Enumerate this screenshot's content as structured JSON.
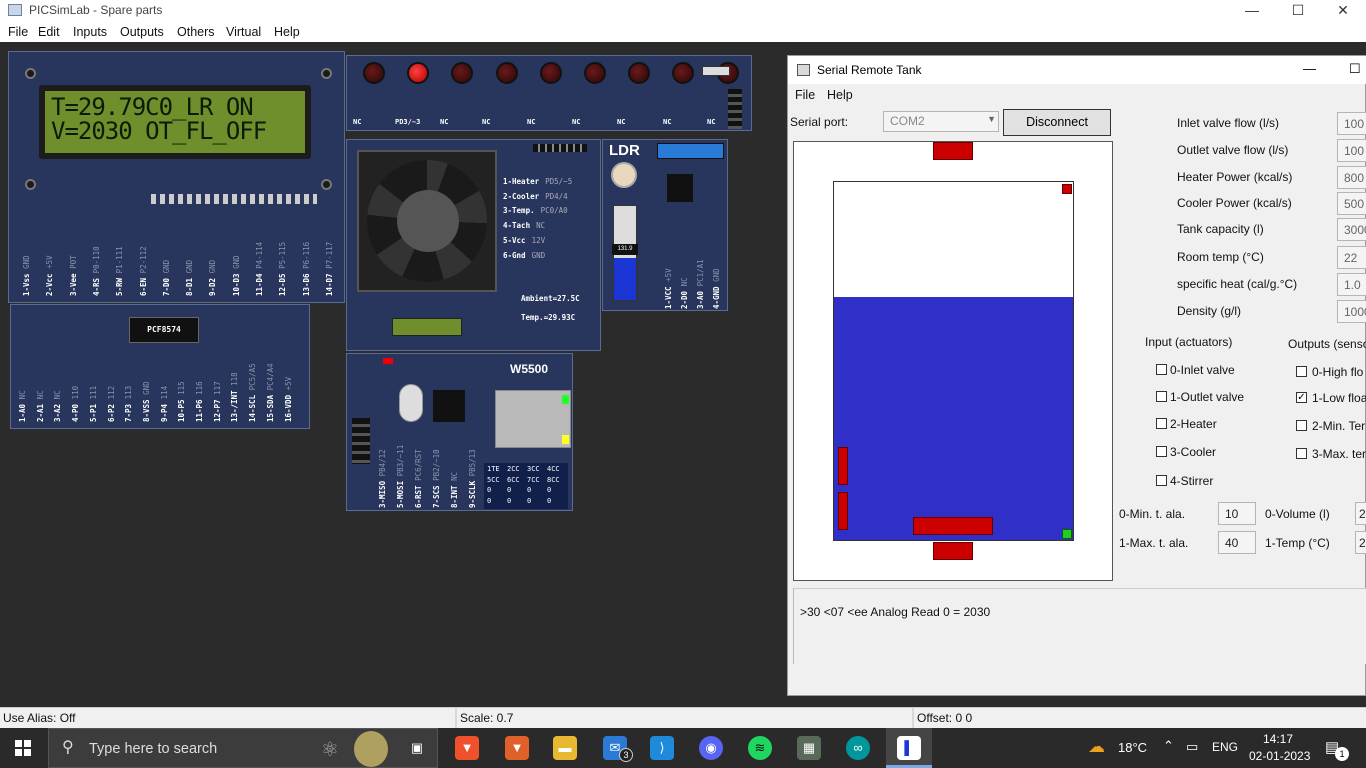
{
  "window": {
    "title": "PICSimLab - Spare parts",
    "minimize": "—",
    "maximize": "☐",
    "close": "✕"
  },
  "menu": [
    "File",
    "Edit",
    "Inputs",
    "Outputs",
    "Others",
    "Virtual",
    "Help"
  ],
  "lcd": {
    "line1": "T=29.79C0_LR ON",
    "line2": "V=2030 OT_FL_OFF",
    "pins": [
      {
        "n": "1-Vss",
        "s": "GND"
      },
      {
        "n": "2-Vcc",
        "s": "+5V"
      },
      {
        "n": "3-Vee",
        "s": "POT"
      },
      {
        "n": "4-RS",
        "s": "P0-110"
      },
      {
        "n": "5-RW",
        "s": "P1-111"
      },
      {
        "n": "6-EN",
        "s": "P2-112"
      },
      {
        "n": "7-D0",
        "s": "GND"
      },
      {
        "n": "8-D1",
        "s": "GND"
      },
      {
        "n": "9-D2",
        "s": "GND"
      },
      {
        "n": "10-D3",
        "s": "GND"
      },
      {
        "n": "11-D4",
        "s": "P4-114"
      },
      {
        "n": "12-D5",
        "s": "P5-115"
      },
      {
        "n": "13-D6",
        "s": "P6-116"
      },
      {
        "n": "14-D7",
        "s": "P7-117"
      }
    ]
  },
  "pcf": {
    "chip": "PCF8574",
    "pins": [
      {
        "n": "1-A0",
        "s": "NC"
      },
      {
        "n": "2-A1",
        "s": "NC"
      },
      {
        "n": "3-A2",
        "s": "NC"
      },
      {
        "n": "4-P0",
        "s": "110"
      },
      {
        "n": "5-P1",
        "s": "111"
      },
      {
        "n": "6-P2",
        "s": "112"
      },
      {
        "n": "7-P3",
        "s": "113"
      },
      {
        "n": "8-VSS",
        "s": "GND"
      },
      {
        "n": "9-P4",
        "s": "114"
      },
      {
        "n": "10-P5",
        "s": "115"
      },
      {
        "n": "11-P6",
        "s": "116"
      },
      {
        "n": "12-P7",
        "s": "117"
      },
      {
        "n": "13-/INT",
        "s": "118"
      },
      {
        "n": "14-SCL",
        "s": "PC5/A5"
      },
      {
        "n": "15-SDA",
        "s": "PC4/A4"
      },
      {
        "n": "16-VDD",
        "s": "+5V"
      }
    ]
  },
  "leds": {
    "labels": [
      "NC",
      "PD3/~3",
      "NC",
      "NC",
      "NC",
      "NC",
      "NC",
      "NC",
      "NC"
    ],
    "states": [
      false,
      true,
      false,
      false,
      false,
      false,
      false,
      false,
      false
    ]
  },
  "fan": {
    "pins": [
      {
        "n": "1-Heater",
        "s": "PD5/~5"
      },
      {
        "n": "2-Cooler",
        "s": "PD4/4"
      },
      {
        "n": "3-Temp.",
        "s": "PC0/A0"
      },
      {
        "n": "4-Tach",
        "s": "NC"
      },
      {
        "n": "5-Vcc",
        "s": "12V"
      },
      {
        "n": "6-Gnd",
        "s": "GND"
      }
    ],
    "ambient": "Ambient=27.5C",
    "temp": "Temp.=29.93C"
  },
  "ldr": {
    "title": "LDR",
    "value": "131.9",
    "pins": [
      {
        "n": "1-VCC",
        "s": "+5V"
      },
      {
        "n": "2-D0",
        "s": "NC"
      },
      {
        "n": "3-A0",
        "s": "PC1/A1"
      },
      {
        "n": "4-GND",
        "s": "GND"
      }
    ]
  },
  "w5500": {
    "title": "W5500",
    "pins": [
      {
        "n": "3-MISO",
        "s": "PB4/12"
      },
      {
        "n": "5-MOSI",
        "s": "PB3/~11"
      },
      {
        "n": "6-RST",
        "s": "PC6/RST"
      },
      {
        "n": "7-SCS",
        "s": "PB2/~10"
      },
      {
        "n": "8-INT",
        "s": "NC"
      },
      {
        "n": "9-SCLK",
        "s": "PB5/13"
      }
    ],
    "table": [
      [
        "1TE",
        "2CC",
        "3CC",
        "4CC"
      ],
      [
        "5CC",
        "6CC",
        "7CC",
        "8CC"
      ],
      [
        "0",
        "0",
        "0",
        "0"
      ],
      [
        "0",
        "0",
        "0",
        "0"
      ]
    ]
  },
  "serial": {
    "title": "Serial Remote Tank",
    "maximize": "☐",
    "minimize": "—",
    "menu": [
      "File",
      "Help"
    ],
    "port_label": "Serial port:",
    "port_value": "COM2",
    "disconnect": "Disconnect",
    "params": [
      {
        "label": "Inlet valve flow (l/s)",
        "value": "100"
      },
      {
        "label": "Outlet valve flow (l/s)",
        "value": "100"
      },
      {
        "label": "Heater Power (kcal/s)",
        "value": "800"
      },
      {
        "label": "Cooler Power (kcal/s)",
        "value": "500"
      },
      {
        "label": "Tank capacity (l)",
        "value": "3000"
      },
      {
        "label": "Room temp (°C)",
        "value": "22"
      },
      {
        "label": "specific heat (cal/g.°C)",
        "value": "1.0"
      },
      {
        "label": "Density (g/l)",
        "value": "1000"
      }
    ],
    "inputs_title": "Input (actuators)",
    "inputs": [
      {
        "label": "0-Inlet valve",
        "checked": false
      },
      {
        "label": "1-Outlet valve",
        "checked": false
      },
      {
        "label": "2-Heater",
        "checked": false
      },
      {
        "label": "3-Cooler",
        "checked": false
      },
      {
        "label": "4-Stirrer",
        "checked": false
      }
    ],
    "outputs_title": "Outputs (senso",
    "outputs": [
      {
        "label": "0-High flo",
        "checked": false
      },
      {
        "label": "1-Low floa",
        "checked": true
      },
      {
        "label": "2-Min. Ter",
        "checked": false
      },
      {
        "label": "3-Max. ter",
        "checked": false
      }
    ],
    "alarms": [
      {
        "label": "0-Min. t. ala.",
        "value": "10"
      },
      {
        "label": "1-Max. t. ala.",
        "value": "40"
      }
    ],
    "readouts": [
      {
        "label": "0-Volume (l)",
        "value": "2"
      },
      {
        "label": "1-Temp (°C)",
        "value": "2"
      }
    ],
    "log": ">30 <07 <ee   Analog Read 0 = 2030",
    "tank_level": 0.68
  },
  "status": {
    "alias": "Use Alias: Off",
    "scale": "Scale: 0.7",
    "offset": "Offset:  0  0"
  },
  "taskbar": {
    "search": "Type here to search",
    "weather": "18°C",
    "lang": "ENG",
    "time": "14:17",
    "date": "02-01-2023",
    "notif": "1",
    "mail_badge": "3"
  }
}
